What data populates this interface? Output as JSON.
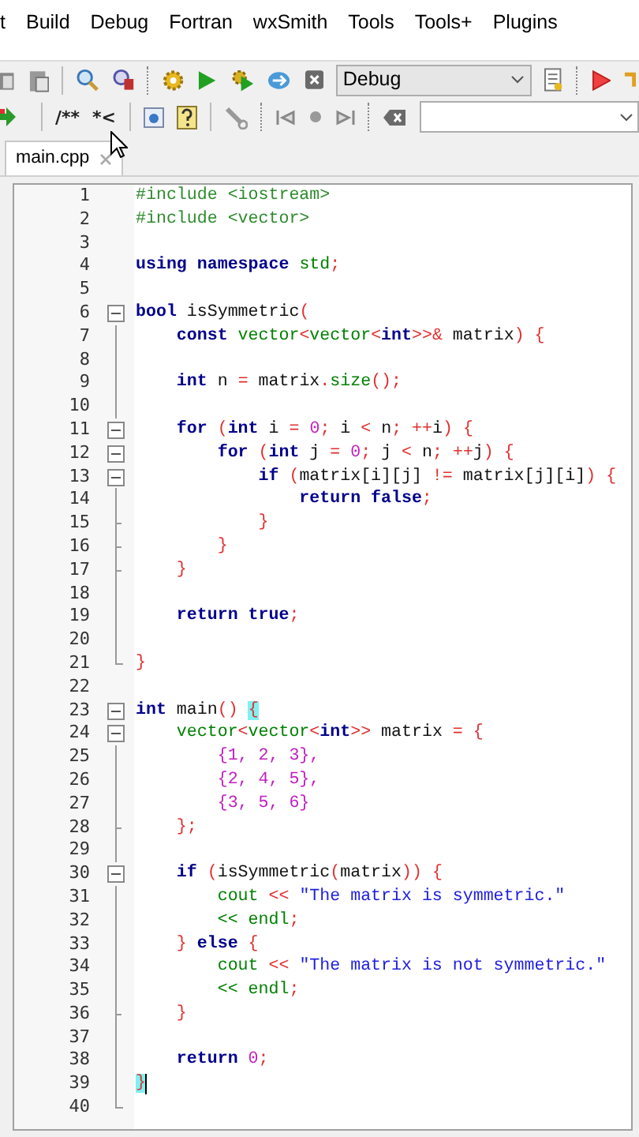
{
  "menu": [
    "t",
    "Build",
    "Debug",
    "Fortran",
    "wxSmith",
    "Tools",
    "Tools+",
    "Plugins"
  ],
  "toolbar": {
    "build_target": "Debug",
    "comment_buttons": [
      "/**",
      "*<"
    ]
  },
  "tabs": [
    {
      "label": "main.cpp",
      "selected": true
    }
  ],
  "editor": {
    "lines": [
      {
        "number": "1",
        "kind": "plain",
        "tokens": [
          {
            "kind": "pre",
            "text": "#include <iostream>"
          }
        ]
      },
      {
        "number": "2",
        "kind": "plain",
        "tokens": [
          {
            "kind": "pre",
            "text": "#include <vector>"
          }
        ]
      },
      {
        "number": "3",
        "kind": "plain"
      },
      {
        "number": "4",
        "kind": "plain",
        "tokens": [
          {
            "kind": "kw",
            "text": "using "
          },
          {
            "kind": "kw",
            "text": "namespace "
          },
          {
            "kind": "lib",
            "text": "std"
          },
          {
            "kind": "op",
            "text": ";"
          }
        ]
      },
      {
        "number": "5",
        "kind": "plain"
      },
      {
        "number": "6",
        "kind": "start",
        "tokens": [
          {
            "kind": "kw",
            "text": "bool"
          },
          {
            "kind": "plain",
            "text": " isSymmetric"
          },
          {
            "kind": "op",
            "text": "("
          }
        ]
      },
      {
        "number": "7",
        "kind": "body",
        "tokens": [
          {
            "kind": "kw",
            "text": "    const "
          },
          {
            "kind": "lib",
            "text": "vector"
          },
          {
            "kind": "op",
            "text": "<"
          },
          {
            "kind": "lib",
            "text": "vector"
          },
          {
            "kind": "op",
            "text": "<"
          },
          {
            "kind": "kw",
            "text": "int"
          },
          {
            "kind": "op",
            "text": ">>&"
          },
          {
            "kind": "plain",
            "text": " matrix"
          },
          {
            "kind": "op",
            "text": ") {"
          }
        ]
      },
      {
        "number": "8",
        "kind": "body"
      },
      {
        "number": "9",
        "kind": "body",
        "tokens": [
          {
            "kind": "kw",
            "text": "    int"
          },
          {
            "kind": "plain",
            "text": " n "
          },
          {
            "kind": "op",
            "text": "="
          },
          {
            "kind": "plain",
            "text": " matrix"
          },
          {
            "kind": "op",
            "text": "."
          },
          {
            "kind": "lib",
            "text": "size"
          },
          {
            "kind": "op",
            "text": "();"
          }
        ]
      },
      {
        "number": "10",
        "kind": "body"
      },
      {
        "number": "11",
        "kind": "start",
        "tokens": [
          {
            "kind": "kw",
            "text": "    for "
          },
          {
            "kind": "op",
            "text": "("
          },
          {
            "kind": "kw",
            "text": "int"
          },
          {
            "kind": "plain",
            "text": " i "
          },
          {
            "kind": "op",
            "text": "= "
          },
          {
            "kind": "num",
            "text": "0"
          },
          {
            "kind": "op",
            "text": "; "
          },
          {
            "kind": "plain",
            "text": "i "
          },
          {
            "kind": "op",
            "text": "<"
          },
          {
            "kind": "plain",
            "text": " n"
          },
          {
            "kind": "op",
            "text": "; ++"
          },
          {
            "kind": "plain",
            "text": "i"
          },
          {
            "kind": "op",
            "text": ") {"
          }
        ]
      },
      {
        "number": "12",
        "kind": "start",
        "tokens": [
          {
            "kind": "kw",
            "text": "        for "
          },
          {
            "kind": "op",
            "text": "("
          },
          {
            "kind": "kw",
            "text": "int"
          },
          {
            "kind": "plain",
            "text": " j "
          },
          {
            "kind": "op",
            "text": "= "
          },
          {
            "kind": "num",
            "text": "0"
          },
          {
            "kind": "op",
            "text": "; "
          },
          {
            "kind": "plain",
            "text": "j "
          },
          {
            "kind": "op",
            "text": "<"
          },
          {
            "kind": "plain",
            "text": " n"
          },
          {
            "kind": "op",
            "text": "; ++"
          },
          {
            "kind": "plain",
            "text": "j"
          },
          {
            "kind": "op",
            "text": ") {"
          }
        ]
      },
      {
        "number": "13",
        "kind": "start",
        "tokens": [
          {
            "kind": "kw",
            "text": "            if "
          },
          {
            "kind": "op",
            "text": "("
          },
          {
            "kind": "plain",
            "text": "matrix[i][j] "
          },
          {
            "kind": "op",
            "text": "!="
          },
          {
            "kind": "plain",
            "text": " matrix[j][i]"
          },
          {
            "kind": "op",
            "text": ") {"
          }
        ]
      },
      {
        "number": "14",
        "kind": "body",
        "tokens": [
          {
            "kind": "kw",
            "text": "                return false"
          },
          {
            "kind": "op",
            "text": ";"
          }
        ]
      },
      {
        "number": "15",
        "kind": "tick",
        "tokens": [
          {
            "kind": "op",
            "text": "            }"
          }
        ]
      },
      {
        "number": "16",
        "kind": "tick",
        "tokens": [
          {
            "kind": "op",
            "text": "        }"
          }
        ]
      },
      {
        "number": "17",
        "kind": "tick",
        "tokens": [
          {
            "kind": "op",
            "text": "    }"
          }
        ]
      },
      {
        "number": "18",
        "kind": "body"
      },
      {
        "number": "19",
        "kind": "body",
        "tokens": [
          {
            "kind": "kw",
            "text": "    return true"
          },
          {
            "kind": "op",
            "text": ";"
          }
        ]
      },
      {
        "number": "20",
        "kind": "body"
      },
      {
        "number": "21",
        "kind": "end",
        "tokens": [
          {
            "kind": "op",
            "text": "}"
          }
        ]
      },
      {
        "number": "22",
        "kind": "plain"
      },
      {
        "number": "23",
        "kind": "start",
        "tokens": [
          {
            "kind": "kw",
            "text": "int"
          },
          {
            "kind": "plain",
            "text": " main"
          },
          {
            "kind": "op",
            "text": "() "
          },
          {
            "kind": "match",
            "text": "{"
          }
        ]
      },
      {
        "number": "24",
        "kind": "start",
        "tokens": [
          {
            "kind": "lib",
            "text": "    vector"
          },
          {
            "kind": "op",
            "text": "<"
          },
          {
            "kind": "lib",
            "text": "vector"
          },
          {
            "kind": "op",
            "text": "<"
          },
          {
            "kind": "kw",
            "text": "int"
          },
          {
            "kind": "op",
            "text": ">>"
          },
          {
            "kind": "plain",
            "text": " matrix "
          },
          {
            "kind": "op",
            "text": "= {"
          }
        ]
      },
      {
        "number": "25",
        "kind": "body",
        "tokens": [
          {
            "kind": "num",
            "text": "        {1, 2, 3},"
          }
        ]
      },
      {
        "number": "26",
        "kind": "body",
        "tokens": [
          {
            "kind": "num",
            "text": "        {2, 4, 5},"
          }
        ]
      },
      {
        "number": "27",
        "kind": "body",
        "tokens": [
          {
            "kind": "num",
            "text": "        {3, 5, 6}"
          }
        ]
      },
      {
        "number": "28",
        "kind": "tick",
        "tokens": [
          {
            "kind": "op",
            "text": "    };"
          }
        ]
      },
      {
        "number": "29",
        "kind": "body"
      },
      {
        "number": "30",
        "kind": "start",
        "tokens": [
          {
            "kind": "kw",
            "text": "    if "
          },
          {
            "kind": "op",
            "text": "("
          },
          {
            "kind": "plain",
            "text": "isSymmetric"
          },
          {
            "kind": "op",
            "text": "("
          },
          {
            "kind": "plain",
            "text": "matrix"
          },
          {
            "kind": "op",
            "text": ")) {"
          }
        ]
      },
      {
        "number": "31",
        "kind": "body",
        "tokens": [
          {
            "kind": "lib",
            "text": "        cout "
          },
          {
            "kind": "op",
            "text": "<< "
          },
          {
            "kind": "str",
            "text": "\"The matrix is symmetric.\""
          }
        ]
      },
      {
        "number": "32",
        "kind": "body",
        "tokens": [
          {
            "kind": "lib",
            "text": "        << endl"
          },
          {
            "kind": "op",
            "text": ";"
          }
        ]
      },
      {
        "number": "33",
        "kind": "body",
        "tokens": [
          {
            "kind": "op",
            "text": "    } "
          },
          {
            "kind": "kw",
            "text": "else "
          },
          {
            "kind": "op",
            "text": "{"
          }
        ]
      },
      {
        "number": "34",
        "kind": "body",
        "tokens": [
          {
            "kind": "lib",
            "text": "        cout "
          },
          {
            "kind": "op",
            "text": "<< "
          },
          {
            "kind": "str",
            "text": "\"The matrix is not symmetric.\""
          }
        ]
      },
      {
        "number": "35",
        "kind": "body",
        "tokens": [
          {
            "kind": "lib",
            "text": "        << endl"
          },
          {
            "kind": "op",
            "text": ";"
          }
        ]
      },
      {
        "number": "36",
        "kind": "tick",
        "tokens": [
          {
            "kind": "op",
            "text": "    }"
          }
        ]
      },
      {
        "number": "37",
        "kind": "body"
      },
      {
        "number": "38",
        "kind": "body",
        "tokens": [
          {
            "kind": "kw",
            "text": "    return "
          },
          {
            "kind": "num",
            "text": "0"
          },
          {
            "kind": "op",
            "text": ";"
          }
        ]
      },
      {
        "number": "39",
        "kind": "body",
        "caret": true,
        "tokens": [
          {
            "kind": "match",
            "text": "}"
          }
        ]
      },
      {
        "number": "40",
        "kind": "end"
      }
    ]
  }
}
